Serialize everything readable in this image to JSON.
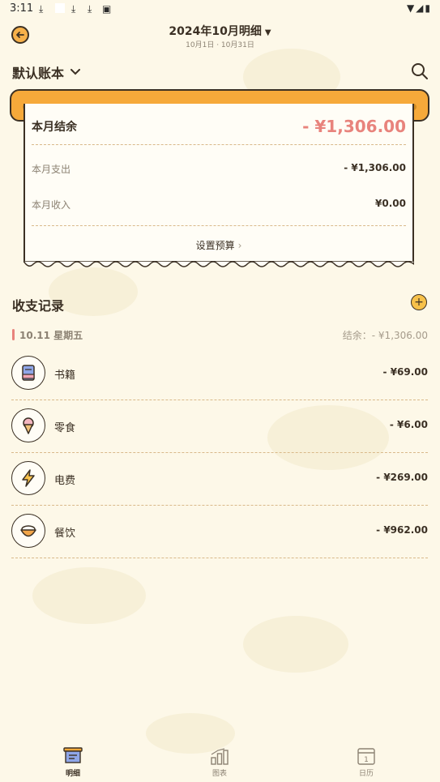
{
  "status_bar": {
    "time": "3:11"
  },
  "header": {
    "title": "2024年10月明细",
    "caret": "▼",
    "subtitle": "10月1日 · 10月31日"
  },
  "account": {
    "name": "默认账本",
    "chevron": "⌄"
  },
  "summary": {
    "balance_label": "本月结余",
    "balance_value": "- ¥1,306.00",
    "expense_label": "本月支出",
    "expense_value": "- ¥1,306.00",
    "income_label": "本月收入",
    "income_value": "¥0.00",
    "budget_label": "设置预算",
    "budget_arrow": "›"
  },
  "records": {
    "title": "收支记录",
    "add_label": "+",
    "date_label": "10.11 星期五",
    "date_balance": "结余：- ¥1,306.00",
    "items": [
      {
        "category": "书籍",
        "amount": "- ¥69.00",
        "icon": "book-icon"
      },
      {
        "category": "零食",
        "amount": "- ¥6.00",
        "icon": "ice-cream-icon"
      },
      {
        "category": "电费",
        "amount": "- ¥269.00",
        "icon": "lightning-icon"
      },
      {
        "category": "餐饮",
        "amount": "- ¥962.00",
        "icon": "rice-bowl-icon"
      }
    ]
  },
  "nav": [
    {
      "label": "明细",
      "icon": "details-icon",
      "active": true
    },
    {
      "label": "图表",
      "icon": "chart-icon",
      "active": false
    },
    {
      "label": "日历",
      "icon": "calendar-icon",
      "active": false
    }
  ],
  "colors": {
    "background": "#fdf8e8",
    "accent_orange": "#f6a93a",
    "negative_red": "#e8837c",
    "ink": "#3b3024"
  }
}
